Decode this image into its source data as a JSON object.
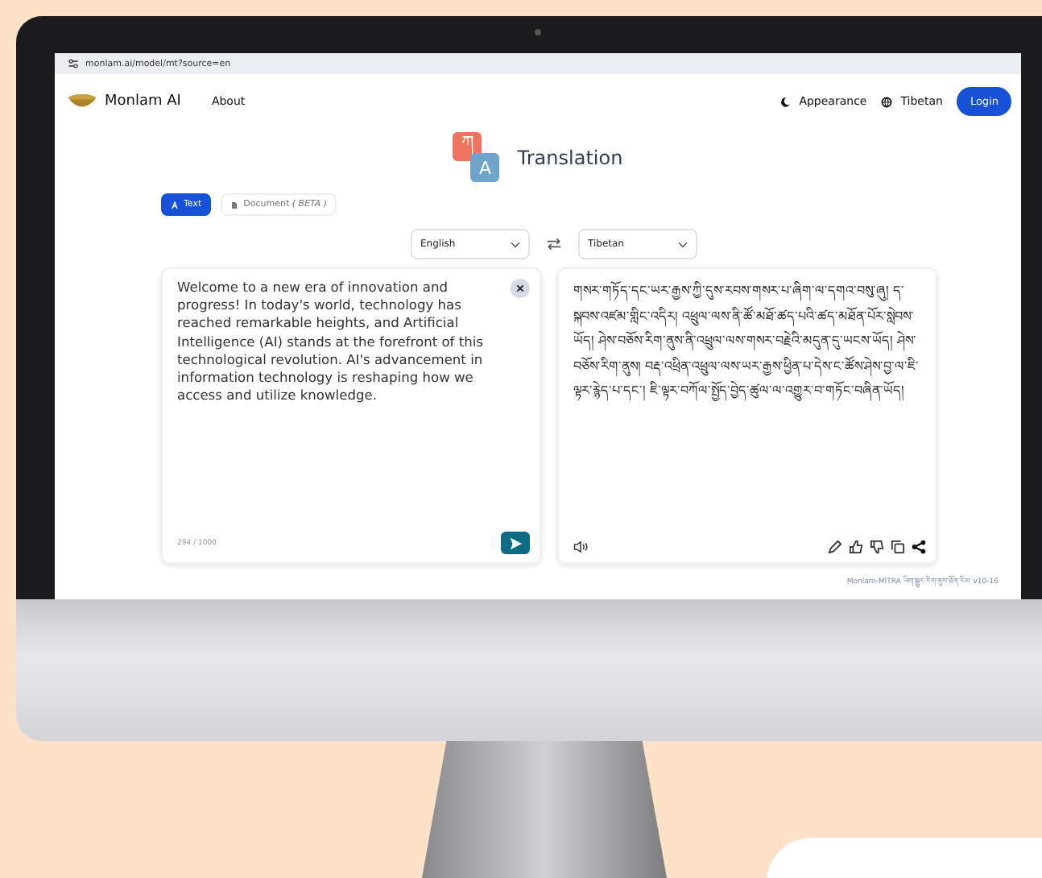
{
  "browser": {
    "url": "monlam.ai/model/mt?source=en"
  },
  "nav": {
    "brand": "Monlam AI",
    "links": [
      "About"
    ],
    "appearance": "Appearance",
    "language": "Tibetan",
    "login": "Login"
  },
  "page": {
    "title": "Translation",
    "icon_glyphs": [
      "ཀ",
      "A"
    ]
  },
  "mode_tabs": [
    {
      "kind": "text",
      "label": "Text",
      "selected": true
    },
    {
      "kind": "document",
      "label": "Document *( BETA )*",
      "selected": false
    }
  ],
  "source_language": "English",
  "target_language": "Tibetan",
  "source": {
    "text": "Welcome to a new era of innovation and progress! In today's world, technology has reached remarkable heights, and Artificial Intelligence (AI) stands at the forefront of this technological revolution. AI's advancement in information technology is reshaping how we access and utilize knowledge.",
    "count": "294 / 1000"
  },
  "target": {
    "text": "གསར་གཏོད་དང་ཡར་རྒྱས་ཀྱི་དུས་རབས་གསར་པ་ཞིག་ལ་དགའ་བསུ་ཞུ། ད་སྐབས་འཛམ་གླིང་འདིར། འཕྲུལ་ལས་ནི་ཚོ་མཐོ་ཚད་པའི་ཚད་མཐོན་པོར་སླེབས་ཡོད། ཤེས་བཅོས་རིག་ནུས་ནི་འཕྲུལ་ལས་གསར་བརྗེའི་མདུན་དུ་ཡངས་ཡོད། ཤེས་བཅོས་རིག་ནུས། བརྡ་འཕྲིན་འཕྲུལ་ལས་ཡར་རྒྱས་ཕྱིན་པ་དེས་ང་ཚོས་ཤེས་བྱ་ལ་ཇི་ལྟར་རྙེད་པ་དང་། ཇི་ལྟར་བཀོལ་སྤྱོད་བྱེད་ཚུལ་ལ་འགྱུར་བ་གཏོང་བཞིན་ཡོད།"
  },
  "footer": "Monlam-MITRA ཡིག་སྒྱུར་རིག་ནུས་ཐོན་རིམ་ v10-16"
}
